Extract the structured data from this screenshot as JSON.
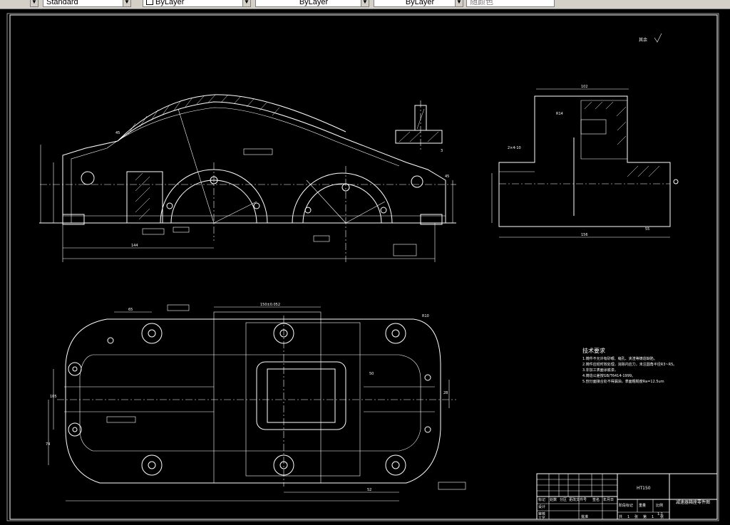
{
  "toolbar": {
    "textstyle_value": "Standard",
    "layer_value": "ByLayer",
    "linetype_value": "ByLayer",
    "lineweight_value": "ByLayer",
    "plotstyle_value": "随颜色"
  },
  "icons": {
    "layer_manager": "layer-stack-icon",
    "swatch": "color-swatch-icon"
  },
  "colors": {
    "canvas": "#000000",
    "linework": "#ffffff",
    "toolbar": "#d4d0c8"
  },
  "drawing": {
    "surface_finish_note": "其余",
    "front_view": {
      "dims": {
        "r45": "45",
        "c3": "3",
        "d144": "144",
        "d45": "45"
      }
    },
    "side_view": {
      "dims": {
        "top": "102",
        "r14": "R14",
        "bottom_left": "156",
        "bottom_right": "55",
        "thread": "2×4-10"
      }
    },
    "top_view": {
      "dims": {
        "d150": "150±0.052",
        "d65": "65",
        "r10": "R10",
        "d50": "50",
        "d52": "52",
        "d105": "105",
        "d28": "28",
        "d74": "74"
      }
    },
    "tech_requirements": {
      "title": "技术要求",
      "lines": [
        "1.铸件不允许有砂眼、缩孔、夹渣等铸造缺陷。",
        "2.铸件应经时效处理，消除内应力，未注圆角半径R3~R5。",
        "3.非加工表面涂底漆。",
        "4.铸造公差按GB/T6414-1999。",
        "5.剖分面接合处不得漏油，表面粗糙度Ra=12.5um"
      ]
    },
    "title_block": {
      "material": "HT150",
      "part_name": "减速器箱座零件图",
      "row_labels": [
        "标记",
        "设计",
        "审核",
        "工艺"
      ],
      "col_labels": [
        "处数",
        "分区",
        "更改文件号",
        "签名",
        "年月日"
      ],
      "stage_labels": [
        "阶段标记",
        "重量",
        "比例"
      ],
      "scale": "1:1",
      "sheet_info": [
        "共",
        "1",
        "张",
        "第",
        "1",
        "张"
      ],
      "approve": "批准"
    }
  }
}
